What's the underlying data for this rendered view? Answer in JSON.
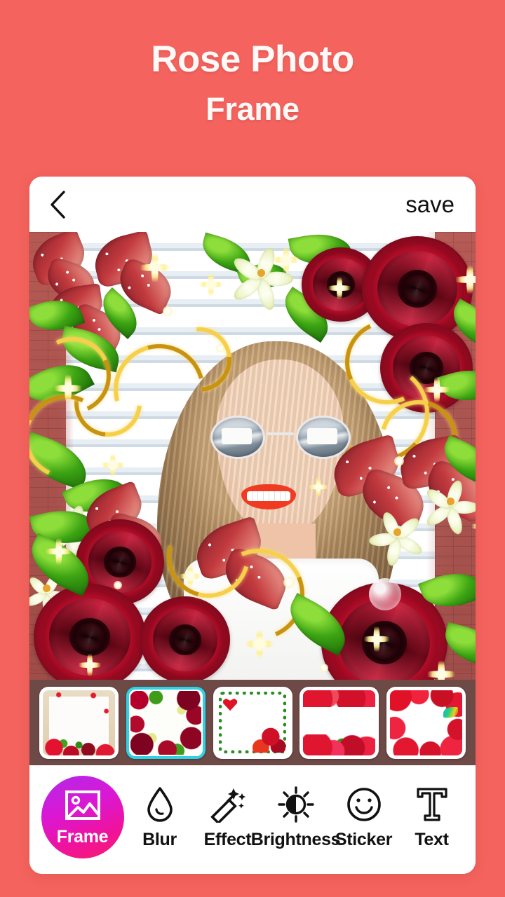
{
  "promo": {
    "title_line1": "Rose Photo",
    "title_line2": "Frame",
    "background_color": "#F4635E"
  },
  "app": {
    "topbar": {
      "back_icon": "chevron-left-icon",
      "save_label": "save"
    },
    "editor": {
      "photo_description": "Woman with round mirrored sunglasses and red lipstick in front of white window blinds",
      "frame_description": "Red rose, lily, butterfly and gold swirl photo frame with sparkles"
    },
    "frames": {
      "selected_index": 1,
      "selection_color": "#2FD2E4",
      "strip_background": "#6E4A47",
      "items": [
        {
          "name": "wooden-frame-roses"
        },
        {
          "name": "rose-wreath-frame"
        },
        {
          "name": "lace-heart-rose-frame"
        },
        {
          "name": "roses-top-bottom-frame"
        },
        {
          "name": "rose-petal-butterfly-frame"
        }
      ]
    },
    "toolbar": {
      "active_color": "#E0159F",
      "items": [
        {
          "label": "Frame",
          "icon": "image-icon",
          "active": true
        },
        {
          "label": "Blur",
          "icon": "droplet-icon",
          "active": false
        },
        {
          "label": "Effect",
          "icon": "magic-wand-icon",
          "active": false
        },
        {
          "label": "Brightness",
          "icon": "brightness-icon",
          "active": false
        },
        {
          "label": "Sticker",
          "icon": "smiley-icon",
          "active": false
        },
        {
          "label": "Text",
          "icon": "text-t-icon",
          "active": false
        }
      ]
    }
  }
}
